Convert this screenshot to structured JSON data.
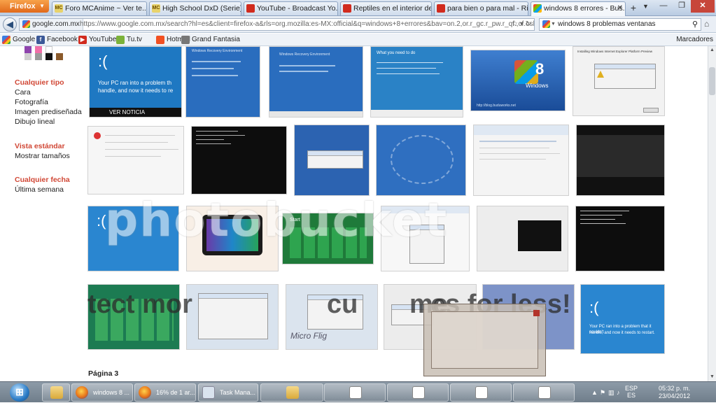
{
  "browser": {
    "app_button": "Firefox",
    "tabs": [
      {
        "title": "Foro MCAnime ~ Ver te...",
        "icon": "mcanime-icon",
        "fav": "mc"
      },
      {
        "title": "High School DxD (Serie)...",
        "icon": "mcanime-icon",
        "fav": "mc"
      },
      {
        "title": "YouTube - Broadcast Yo...",
        "icon": "youtube-icon",
        "fav": "yt"
      },
      {
        "title": "Reptiles en el interior del...",
        "icon": "youtube-icon",
        "fav": "yt"
      },
      {
        "title": "para bien o para mal - Ri...",
        "icon": "youtube-icon",
        "fav": "yt"
      },
      {
        "title": "windows 8 errores - Bus...",
        "icon": "windows-icon",
        "fav": "win"
      }
    ],
    "new_tab": "+",
    "url_site": "google.com.mx",
    "url_full": "https://www.google.com.mx/search?hl=es&client=firefox-a&rls=org.mozilla:es-MX:official&q=windows+8+errores&bav=on.2,or.r_gc.r_pw.r_qf.,cf.osb",
    "search_query": "windows 8 problemas ventanas",
    "bookmarks": [
      {
        "label": "Google",
        "icon": "google-icon",
        "cls": "gg",
        "glyph": ""
      },
      {
        "label": "Facebook",
        "icon": "facebook-icon",
        "cls": "fb",
        "glyph": "f"
      },
      {
        "label": "YouTube",
        "icon": "youtube-icon",
        "cls": "yt",
        "glyph": "▶"
      },
      {
        "label": "Tu.tv",
        "icon": "tutv-icon",
        "cls": "tu",
        "glyph": ""
      },
      {
        "label": "Hotmail",
        "icon": "hotmail-icon",
        "cls": "hm",
        "glyph": ""
      },
      {
        "label": "Grand Fantasia",
        "icon": "page-icon",
        "cls": "gf",
        "glyph": ""
      }
    ],
    "bookmarks_menu": "Marcadores"
  },
  "sidebar": {
    "colors": [
      "#8e44ad",
      "#f06fa8",
      "#ffffff",
      "#cfcfcf",
      "#9a9a9a",
      "#111111",
      "#8b5a2b"
    ],
    "sections": [
      {
        "heading": "Cualquier tipo",
        "items": [
          "Cara",
          "Fotografía",
          "Imagen prediseñada",
          "Dibujo lineal"
        ]
      },
      {
        "heading": "Vista estándar",
        "items": [
          "Mostrar tamaños"
        ]
      },
      {
        "heading": "Cualquier fecha",
        "items": [
          "Última semana"
        ]
      }
    ]
  },
  "results": {
    "thumb_texts": {
      "bsod_msg_1": "Your PC ran into a problem th",
      "bsod_msg_2": "handle, and now it needs to re",
      "ver_noticia": "VER NOTICIA",
      "win_recovery": "Windows Recovery Environment",
      "what_you_need": "What you need to do",
      "windows": "Windows",
      "eight": "8",
      "blog_url": "http://blog.buduworks.net",
      "install_error": "Installing Windows Internet Explorer Platform Preview",
      "start": "Start",
      "bsod_msg_3": "Your PC ran into a problem that it couldn't",
      "bsod_msg_4": "handle, and now it needs to restart."
    },
    "watermark": "photobucket",
    "ad_text_left": "tect mor",
    "ad_text_mid": "cu",
    "ad_text_mid2": "me",
    "ad_text_right": "es for less!",
    "ad_brand": "Micro Flig",
    "page_label": "Página 3"
  },
  "taskbar": {
    "items": [
      {
        "label": "",
        "icon": "internet-explorer-icon",
        "cls": "ie"
      },
      {
        "label": "",
        "icon": "folder-icon",
        "cls": "folder"
      },
      {
        "label": "windows 8 ...",
        "icon": "firefox-icon",
        "cls": "ff"
      },
      {
        "label": "16% de 1 ar...",
        "icon": "firefox-icon",
        "cls": "ff"
      },
      {
        "label": "Task Mana...",
        "icon": "task-manager-icon",
        "cls": "tm"
      },
      {
        "label": "",
        "icon": "folder-icon",
        "cls": "folder"
      },
      {
        "label": "",
        "icon": "window-icon",
        "cls": "doc"
      },
      {
        "label": "",
        "icon": "window-icon",
        "cls": "doc"
      },
      {
        "label": "",
        "icon": "window-icon",
        "cls": "doc"
      },
      {
        "label": "",
        "icon": "window-icon",
        "cls": "doc"
      }
    ],
    "lang_top": "ESP",
    "lang_bottom": "ES",
    "time": "05:32 p. m.",
    "date": "23/04/2012"
  }
}
